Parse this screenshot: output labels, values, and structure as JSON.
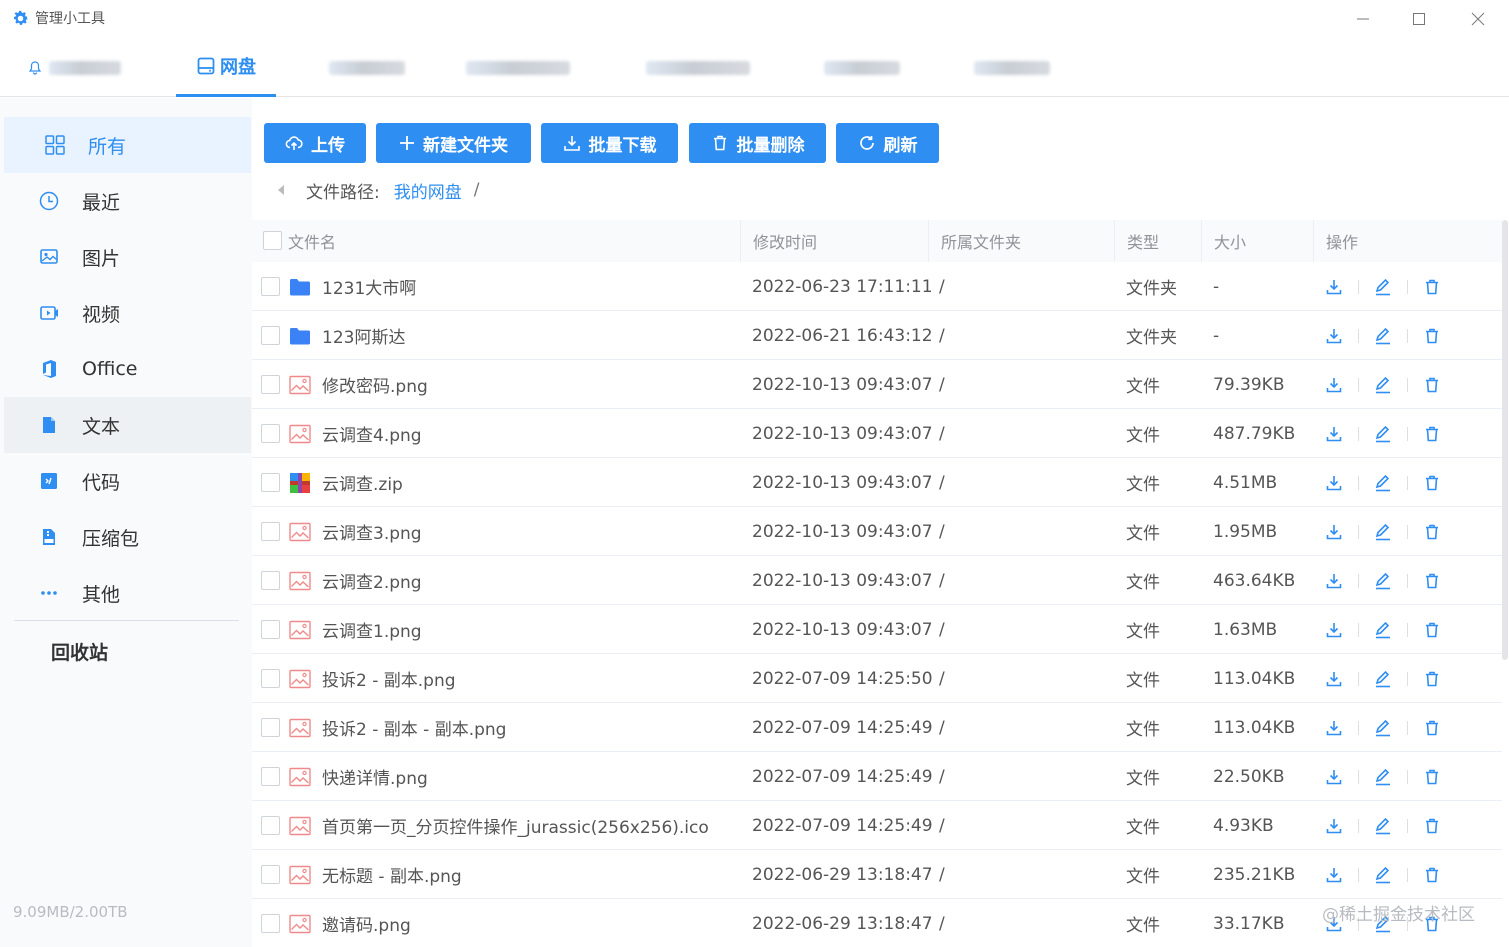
{
  "window": {
    "title": "管理小工具",
    "icon": "gear-icon"
  },
  "topnav": {
    "tabs": [
      {
        "label": "",
        "icon": "bell-icon",
        "blurred": true
      },
      {
        "label": "网盘",
        "icon": "disk-icon",
        "active": true
      },
      {
        "label": "",
        "blurred": true
      },
      {
        "label": "",
        "blurred": true
      },
      {
        "label": "",
        "blurred": true
      },
      {
        "label": "",
        "blurred": true
      },
      {
        "label": "",
        "blurred": true
      }
    ]
  },
  "sidebar": {
    "items": [
      {
        "label": "所有",
        "icon": "grid-icon",
        "active": true
      },
      {
        "label": "最近",
        "icon": "clock-icon"
      },
      {
        "label": "图片",
        "icon": "image-icon"
      },
      {
        "label": "视频",
        "icon": "video-icon"
      },
      {
        "label": "Office",
        "icon": "office-icon"
      },
      {
        "label": "文本",
        "icon": "text-file-icon"
      },
      {
        "label": "代码",
        "icon": "code-icon"
      },
      {
        "label": "压缩包",
        "icon": "archive-icon"
      },
      {
        "label": "其他",
        "icon": "more-icon"
      }
    ],
    "recycle": "回收站",
    "storage": "9.09MB/2.00TB"
  },
  "toolbar": {
    "upload": "上传",
    "new_folder": "新建文件夹",
    "batch_download": "批量下载",
    "batch_delete": "批量删除",
    "refresh": "刷新"
  },
  "breadcrumb": {
    "prefix": "文件路径:",
    "root": "我的网盘",
    "separator": "/"
  },
  "table": {
    "headers": {
      "name": "文件名",
      "modified": "修改时间",
      "folder": "所属文件夹",
      "type": "类型",
      "size": "大小",
      "actions": "操作"
    },
    "rows": [
      {
        "name": "1231大市啊",
        "modified": "2022-06-23 17:11:11",
        "folder": "/",
        "type": "文件夹",
        "size": "-",
        "icon": "folder-icon"
      },
      {
        "name": "123阿斯达",
        "modified": "2022-06-21 16:43:12",
        "folder": "/",
        "type": "文件夹",
        "size": "-",
        "icon": "folder-icon"
      },
      {
        "name": "修改密码.png",
        "modified": "2022-10-13 09:43:07",
        "folder": "/",
        "type": "文件",
        "size": "79.39KB",
        "icon": "image-file-icon"
      },
      {
        "name": "云调查4.png",
        "modified": "2022-10-13 09:43:07",
        "folder": "/",
        "type": "文件",
        "size": "487.79KB",
        "icon": "image-file-icon"
      },
      {
        "name": "云调查.zip",
        "modified": "2022-10-13 09:43:07",
        "folder": "/",
        "type": "文件",
        "size": "4.51MB",
        "icon": "zip-file-icon"
      },
      {
        "name": "云调查3.png",
        "modified": "2022-10-13 09:43:07",
        "folder": "/",
        "type": "文件",
        "size": "1.95MB",
        "icon": "image-file-icon"
      },
      {
        "name": "云调查2.png",
        "modified": "2022-10-13 09:43:07",
        "folder": "/",
        "type": "文件",
        "size": "463.64KB",
        "icon": "image-file-icon"
      },
      {
        "name": "云调查1.png",
        "modified": "2022-10-13 09:43:07",
        "folder": "/",
        "type": "文件",
        "size": "1.63MB",
        "icon": "image-file-icon"
      },
      {
        "name": "投诉2 - 副本.png",
        "modified": "2022-07-09 14:25:50",
        "folder": "/",
        "type": "文件",
        "size": "113.04KB",
        "icon": "image-file-icon"
      },
      {
        "name": "投诉2 - 副本 - 副本.png",
        "modified": "2022-07-09 14:25:49",
        "folder": "/",
        "type": "文件",
        "size": "113.04KB",
        "icon": "image-file-icon"
      },
      {
        "name": "快递详情.png",
        "modified": "2022-07-09 14:25:49",
        "folder": "/",
        "type": "文件",
        "size": "22.50KB",
        "icon": "image-file-icon"
      },
      {
        "name": "首页第一页_分页控件操作_jurassic(256x256).ico",
        "modified": "2022-07-09 14:25:49",
        "folder": "/",
        "type": "文件",
        "size": "4.93KB",
        "icon": "image-file-icon"
      },
      {
        "name": "无标题 - 副本.png",
        "modified": "2022-06-29 13:18:47",
        "folder": "/",
        "type": "文件",
        "size": "235.21KB",
        "icon": "image-file-icon"
      },
      {
        "name": "邀请码.png",
        "modified": "2022-06-29 13:18:47",
        "folder": "/",
        "type": "文件",
        "size": "33.17KB",
        "icon": "image-file-icon"
      }
    ]
  },
  "watermark": "@稀土掘金技术社区",
  "colors": {
    "accent": "#2f8ef1",
    "sidebar_bg": "#f9fafb",
    "sidebar_active_bg": "#e8f3ff",
    "folder": "#3b82f6",
    "image_file": "#f08a8a"
  }
}
